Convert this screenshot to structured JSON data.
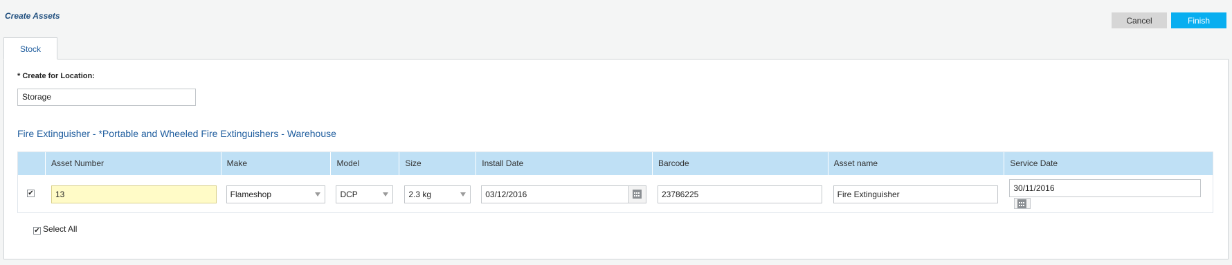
{
  "header": {
    "title": "Create Assets",
    "cancel_label": "Cancel",
    "finish_label": "Finish",
    "accent": "#08aef0"
  },
  "tabs": [
    {
      "label": "Stock",
      "active": true
    }
  ],
  "location": {
    "label": "* Create for Location:",
    "value": "Storage"
  },
  "section": {
    "title": "Fire Extinguisher - *Portable and Wheeled Fire Extinguishers - Warehouse"
  },
  "grid": {
    "columns": [
      "Asset Number",
      "Make",
      "Model",
      "Size",
      "Install Date",
      "Barcode",
      "Asset name",
      "Service Date"
    ],
    "rows": [
      {
        "checked": true,
        "asset_number": "13",
        "make": "Flameshop",
        "model": "DCP",
        "size": "2.3 kg",
        "install_date": "03/12/2016",
        "barcode": "23786225",
        "asset_name": "Fire Extinguisher",
        "service_date": "30/11/2016"
      }
    ]
  },
  "select_all": {
    "label": "Select All",
    "checked": true
  },
  "icons": {
    "checkbox": "check-icon",
    "calendar": "calendar-icon",
    "dropdown": "chevron-down-icon"
  }
}
